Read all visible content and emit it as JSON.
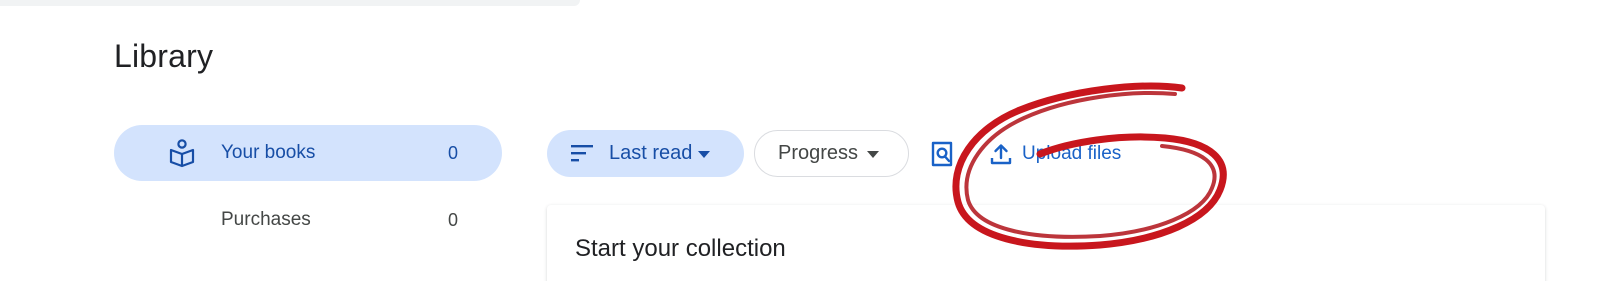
{
  "page": {
    "title": "Library"
  },
  "sidebar": {
    "items": [
      {
        "label": "Your books",
        "count": "0",
        "icon": "book-reader-icon",
        "active": true
      },
      {
        "label": "Purchases",
        "count": "0"
      }
    ]
  },
  "toolbar": {
    "sort": {
      "label": "Last read",
      "icon": "sort-icon"
    },
    "progress": {
      "label": "Progress"
    },
    "search_icon": "search-document-icon",
    "upload": {
      "label": "Upload files",
      "icon": "upload-icon"
    }
  },
  "main": {
    "card": {
      "title": "Start your collection"
    }
  },
  "colors": {
    "accent": "#1a62c7",
    "chip_bg": "#d3e3fd",
    "annotation": "#c8161d"
  }
}
